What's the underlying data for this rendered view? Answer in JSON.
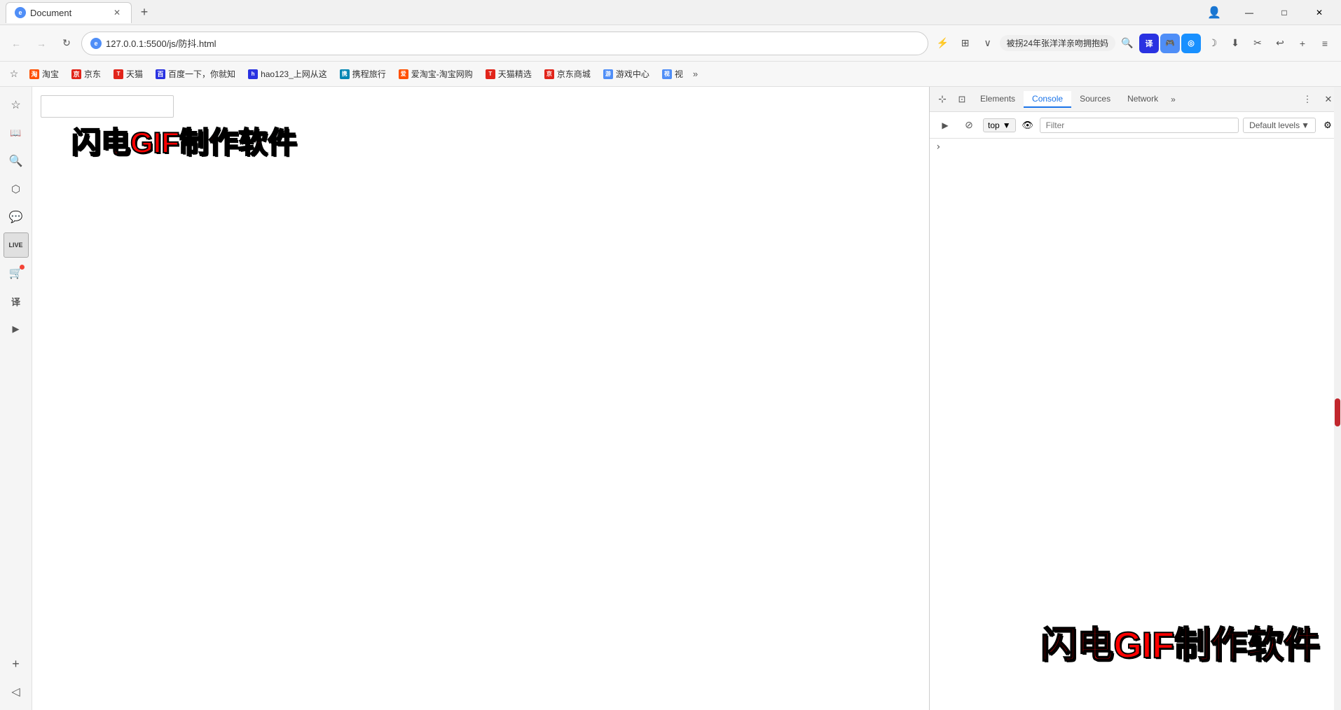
{
  "titlebar": {
    "tab": {
      "title": "Document",
      "favicon_text": "e"
    },
    "new_tab_label": "+",
    "controls": {
      "minimize": "—",
      "maximize": "□",
      "close": "✕"
    }
  },
  "addressbar": {
    "url": "127.0.0.1:5500/js/防抖.html",
    "favicon_text": "e",
    "news_badge": "被拐24年张洋洋亲吻拥抱妈",
    "back_icon": "←",
    "forward_icon": "→",
    "refresh_icon": "↻",
    "home_icon": "⌂"
  },
  "bookmarks": [
    {
      "label": "淘宝",
      "color": "#ff5000"
    },
    {
      "label": "京东",
      "color": "#e1251b"
    },
    {
      "label": "天猫",
      "color": "#e1251b"
    },
    {
      "label": "百度一下，你就知",
      "color": "#2932e1"
    },
    {
      "label": "hao123_上网从这",
      "color": "#2932e1"
    },
    {
      "label": "携程旅行",
      "color": "#0086b3"
    },
    {
      "label": "爱淘宝-淘宝网购",
      "color": "#ff5000"
    },
    {
      "label": "天猫精选",
      "color": "#e1251b"
    },
    {
      "label": "京东商城",
      "color": "#e1251b"
    },
    {
      "label": "游戏中心",
      "color": "#4f8ef7"
    },
    {
      "label": "视",
      "color": "#4f8ef7"
    }
  ],
  "sidebar": {
    "icons": [
      {
        "id": "favorite",
        "symbol": "☆",
        "title": "收藏"
      },
      {
        "id": "reading-list",
        "symbol": "📖",
        "title": "阅读列表"
      },
      {
        "id": "search",
        "symbol": "🔍",
        "title": "搜索"
      },
      {
        "id": "collections",
        "symbol": "⬡",
        "title": "集锦"
      },
      {
        "id": "chat",
        "symbol": "💬",
        "title": "聊天"
      },
      {
        "id": "live",
        "symbol": "LIVE",
        "title": "直播"
      },
      {
        "id": "cart",
        "symbol": "🛒",
        "title": "购物车"
      },
      {
        "id": "translate",
        "symbol": "译",
        "title": "翻译"
      },
      {
        "id": "video",
        "symbol": "▶",
        "title": "视频"
      }
    ],
    "bottom_icons": [
      {
        "id": "add",
        "symbol": "+",
        "title": "添加"
      },
      {
        "id": "collapse",
        "symbol": "◁",
        "title": "收起"
      }
    ]
  },
  "page": {
    "input_placeholder": ""
  },
  "watermark": {
    "text": "闪电GIF制作软件"
  },
  "devtools": {
    "tabs": [
      {
        "id": "elements",
        "label": "Elements"
      },
      {
        "id": "console",
        "label": "Console"
      },
      {
        "id": "sources",
        "label": "Sources"
      },
      {
        "id": "network",
        "label": "Network"
      }
    ],
    "more_label": "»",
    "console_bar": {
      "top_value": "top",
      "filter_placeholder": "Filter",
      "default_levels": "Default levels"
    },
    "console_caret": "›"
  }
}
